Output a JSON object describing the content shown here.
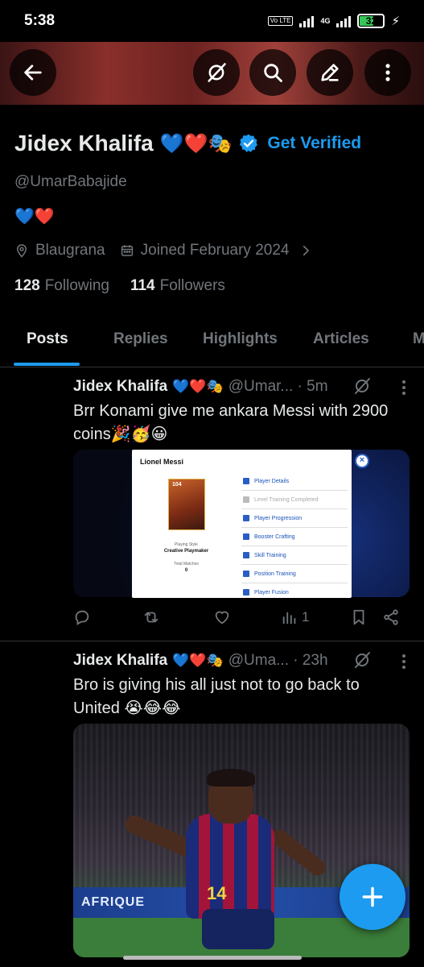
{
  "status_bar": {
    "time": "5:38",
    "volte_label": "Vo LTE",
    "network_label": "4G",
    "battery_level": "32"
  },
  "header": {
    "back_icon": "arrow-left-icon",
    "grok_icon": "grok-icon",
    "search_icon": "search-icon",
    "edit_icon": "pencil-icon",
    "more_icon": "more-vertical-icon"
  },
  "profile": {
    "name": "Jidex Khalifa",
    "name_emojis": "💙❤️🎭",
    "get_verified": "Get Verified",
    "handle": "@UmarBabajide",
    "bio": "💙❤️",
    "location": "Blaugrana",
    "joined": "Joined February 2024",
    "following_count": "128",
    "following_label": "Following",
    "followers_count": "114",
    "followers_label": "Followers"
  },
  "tabs": [
    {
      "label": "Posts",
      "active": true
    },
    {
      "label": "Replies",
      "active": false
    },
    {
      "label": "Highlights",
      "active": false
    },
    {
      "label": "Articles",
      "active": false
    },
    {
      "label": "M",
      "active": false
    }
  ],
  "posts": [
    {
      "name": "Jidex Khalifa",
      "emojis": "💙❤️🎭",
      "handle_time": "@Umar... · 5m",
      "text": "Brr Konami give me ankara Messi with 2900 coins🎉🥳😀",
      "media": {
        "popup_title": "Lionel Messi",
        "card_rating": "104",
        "playing_style_label": "Playing Style",
        "playing_style": "Creative Playmaker",
        "matches_label": "Total Matches",
        "matches": "0",
        "menu": [
          {
            "label": "Player Details",
            "dim": false
          },
          {
            "label": "Level Training Completed",
            "dim": true
          },
          {
            "label": "Player Progression",
            "dim": false
          },
          {
            "label": "Booster Crafting",
            "dim": false
          },
          {
            "label": "Skill Training",
            "dim": false
          },
          {
            "label": "Position Training",
            "dim": false
          },
          {
            "label": "Player Fusion",
            "dim": false
          }
        ]
      },
      "views": "1"
    },
    {
      "name": "Jidex Khalifa",
      "emojis": "💙❤️🎭",
      "handle_time": "@Uma... · 23h",
      "text": "Bro is giving his all just not to go back to United 😭😂😂",
      "media": {
        "board_text": "AFRIQUE",
        "shirt_number": "14"
      }
    }
  ],
  "colors": {
    "accent": "#1d9bf0",
    "text_primary": "#e7e9ea",
    "text_secondary": "#71767b",
    "background": "#000000"
  }
}
